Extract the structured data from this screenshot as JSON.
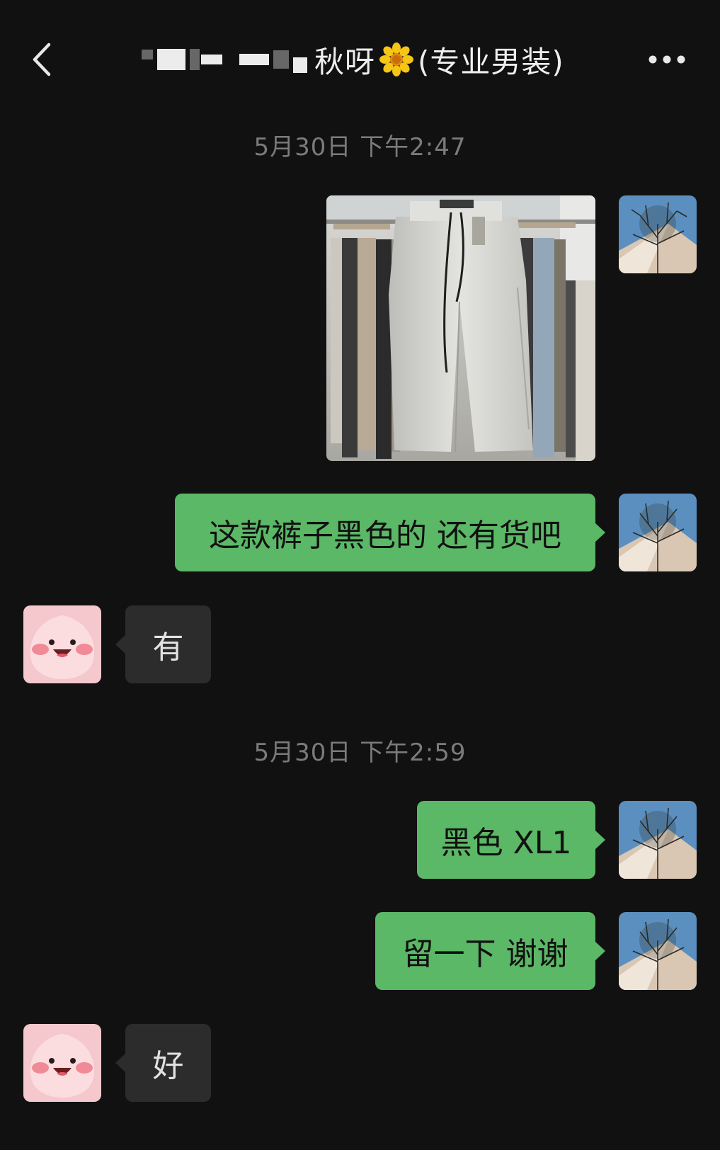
{
  "header": {
    "title_visible": "秋呀",
    "title_suffix": "(专业男装)",
    "back_icon": "chevron-left-icon",
    "more_icon": "more-dots-icon",
    "flower_icon": "sunflower-emoji"
  },
  "messages": [
    {
      "type": "timestamp",
      "text": "5月30日 下午2:47"
    },
    {
      "type": "image",
      "from": "me",
      "alt": "pants-photo"
    },
    {
      "type": "text",
      "from": "me",
      "text": "这款裤子黑色的 还有货吧"
    },
    {
      "type": "text",
      "from": "them",
      "text": "有"
    },
    {
      "type": "timestamp",
      "text": "5月30日 下午2:59"
    },
    {
      "type": "text",
      "from": "me",
      "text": "黑色 XL1"
    },
    {
      "type": "text",
      "from": "me",
      "text": "留一下 谢谢"
    },
    {
      "type": "text",
      "from": "them",
      "text": "好"
    }
  ],
  "colors": {
    "background": "#111111",
    "my_bubble": "#5bb866",
    "their_bubble": "#2c2c2c",
    "timestamp": "#7b7b7b"
  }
}
